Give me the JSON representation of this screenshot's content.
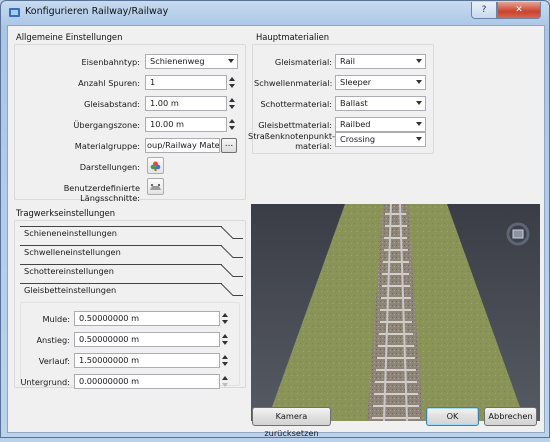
{
  "window": {
    "title": "Konfigurieren Railway/Railway"
  },
  "titlebar": {
    "help_label": "?",
    "close_label": "✕"
  },
  "general": {
    "heading": "Allgemeine Einstellungen",
    "track_type_label": "Eisenbahntyp:",
    "track_type_value": "Schienenweg",
    "tracks_label": "Anzahl Spuren:",
    "tracks_value": "1",
    "gauge_label": "Gleisabstand:",
    "gauge_value": "1.00 m",
    "transition_label": "Übergangszone:",
    "transition_value": "10.00 m",
    "material_group_label": "Materialgruppe:",
    "material_group_value": "oup/Railway Materials",
    "browse_label": "...",
    "displays_label": "Darstellungen:",
    "custom_sections_label": "Benutzerdefinierte Längsschnitte:"
  },
  "materials": {
    "heading": "Hauptmaterialien",
    "rows": [
      {
        "label": "Gleismaterial:",
        "value": "Rail"
      },
      {
        "label": "Schwellenmaterial:",
        "value": "Sleeper"
      },
      {
        "label": "Schottermaterial:",
        "value": "Ballast"
      },
      {
        "label": "Gleisbettmaterial:",
        "value": "Railbed"
      }
    ],
    "crossing_label_line1": "Straßenknotenpunkt-",
    "crossing_label_line2": "material:",
    "crossing_value": "Crossing"
  },
  "structure": {
    "heading": "Tragwerkseinstellungen",
    "sections": [
      "Schieneneinstellungen",
      "Schwelleneinstellungen",
      "Schottereinstellungen",
      "Gleisbetteinstellungen"
    ],
    "fields": [
      {
        "label": "Mulde:",
        "value": "0.50000000 m"
      },
      {
        "label": "Anstieg:",
        "value": "0.50000000 m"
      },
      {
        "label": "Verlauf:",
        "value": "1.50000000 m"
      },
      {
        "label": "Untergrund:",
        "value": "0.00000000 m"
      }
    ]
  },
  "buttons": {
    "reset_camera": "Kamera zurücksetzen",
    "ok": "OK",
    "cancel": "Abbrechen"
  },
  "colors": {
    "sky": "#3f424c",
    "grass": "#8a9358",
    "ballast": "#8e8578",
    "rail": "#c9c9c9"
  }
}
